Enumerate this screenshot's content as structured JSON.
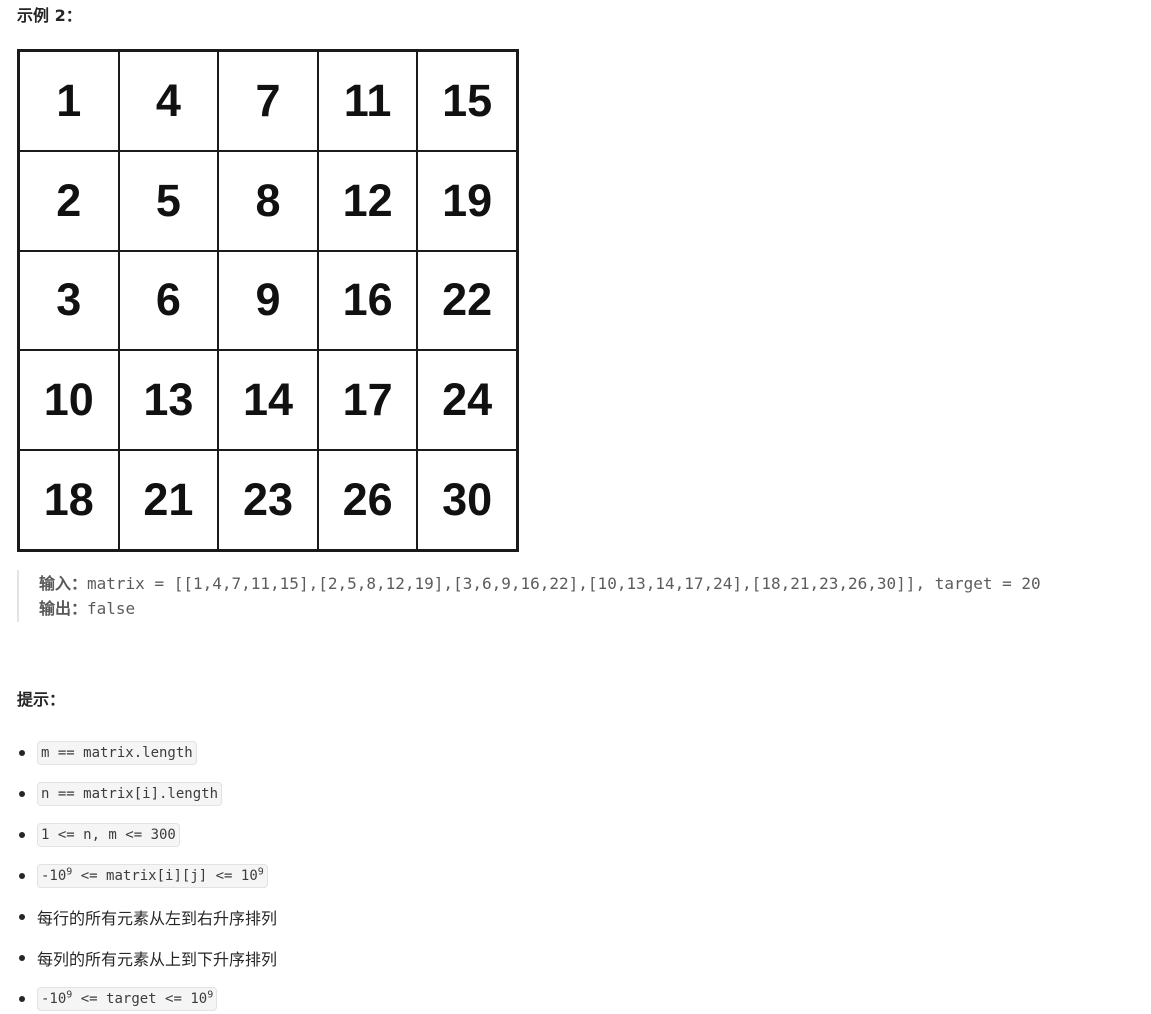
{
  "example": {
    "title": "示例 2："
  },
  "matrix": [
    [
      "1",
      "4",
      "7",
      "11",
      "15"
    ],
    [
      "2",
      "5",
      "8",
      "12",
      "19"
    ],
    [
      "3",
      "6",
      "9",
      "16",
      "22"
    ],
    [
      "10",
      "13",
      "14",
      "17",
      "24"
    ],
    [
      "18",
      "21",
      "23",
      "26",
      "30"
    ]
  ],
  "io": {
    "input_label": "输入：",
    "input_value": "matrix = [[1,4,7,11,15],[2,5,8,12,19],[3,6,9,16,22],[10,13,14,17,24],[18,21,23,26,30]], target = 20",
    "output_label": "输出：",
    "output_value": "false"
  },
  "hints": {
    "title": "提示：",
    "items": [
      {
        "text": "m == matrix.length"
      },
      {
        "text": "n == matrix[i].length"
      },
      {
        "text": "1 <= n, m <= 300"
      },
      {
        "pre": "-10",
        "sup1": "9",
        "mid": " <= matrix[i][j] <= 10",
        "sup2": "9"
      },
      {
        "text": "每行的所有元素从左到右升序排列"
      },
      {
        "text": "每列的所有元素从上到下升序排列"
      },
      {
        "pre": "-10",
        "sup1": "9",
        "mid": " <= target <= 10",
        "sup2": "9"
      }
    ]
  }
}
